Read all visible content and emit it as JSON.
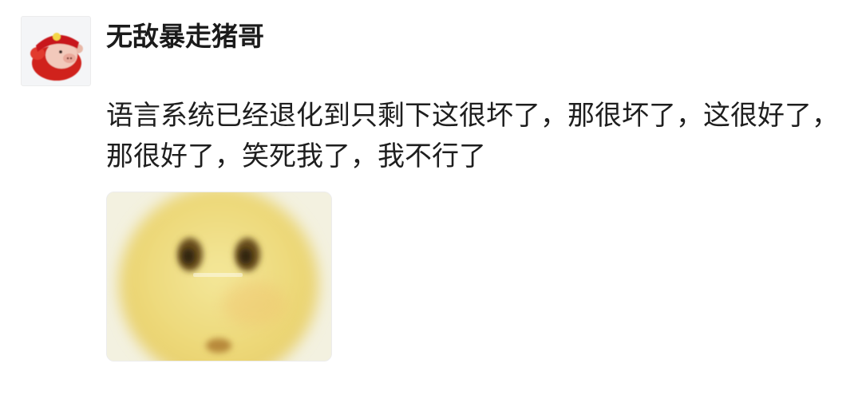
{
  "post": {
    "username": "无敌暴走猪哥",
    "text": "语言系统已经退化到只剩下这很坏了，那很坏了，这很好了，那很好了，笑死我了，我不行了",
    "avatar_icon": "red-cartoon-pig-avatar",
    "image_icon": "blurry-yellow-emoji-face"
  }
}
